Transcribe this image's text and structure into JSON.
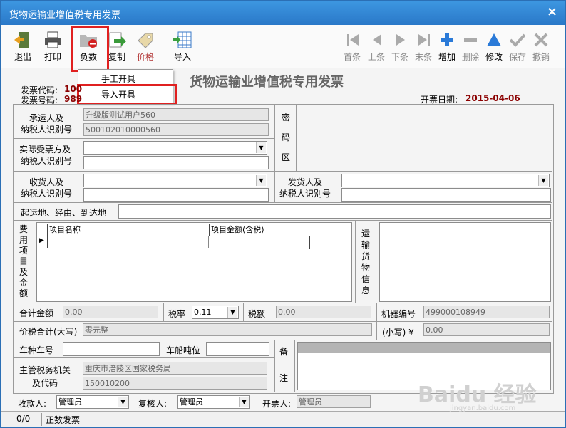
{
  "window": {
    "title": "货物运输业增值税专用发票",
    "close": "×"
  },
  "toolbar": {
    "exit": "退出",
    "print": "打印",
    "negative": "负数",
    "copy": "复制",
    "price": "价格",
    "import": "导入",
    "first": "首条",
    "prev": "上条",
    "next": "下条",
    "last": "末条",
    "add": "增加",
    "delete": "删除",
    "modify": "修改",
    "save": "保存",
    "undo": "撤销"
  },
  "menu": {
    "manual": "手工开具",
    "import": "导入开具"
  },
  "form": {
    "title": "货物运输业增值税专用发票",
    "code_label": "发票代码:",
    "code_value": "100",
    "number_label": "发票号码:",
    "number_value": "989",
    "date_label": "开票日期:",
    "date_value": "2015-04-06",
    "carrier_label_1": "承运人及",
    "carrier_label_2": "纳税人识别号",
    "carrier_name": "升级版测试用户560",
    "carrier_taxid": "500102010000560",
    "cipher_label": "密\n码\n区",
    "cipher_1": "密",
    "cipher_2": "码",
    "cipher_3": "区",
    "recipient_label_1": "实际受票方及",
    "recipient_label_2": "纳税人识别号",
    "consignee_label_1": "收货人及",
    "consignee_label_2": "纳税人识别号",
    "shipper_label_1": "发货人及",
    "shipper_label_2": "纳税人识别号",
    "route_label": "起运地、经由、到达地",
    "fee_chars": [
      "费",
      "用",
      "项",
      "目",
      "及",
      "金",
      "额"
    ],
    "grid_col1": "项目名称",
    "grid_col2": "项目金额(含税)",
    "cargo_chars": [
      "运",
      "输",
      "货",
      "物",
      "信",
      "息"
    ],
    "total_label": "合计金额",
    "total_value": "0.00",
    "rate_label": "税率",
    "rate_value": "0.11",
    "tax_label": "税额",
    "tax_value": "0.00",
    "machine_label": "机器编号",
    "machine_value": "499000108949",
    "sum_upper_label": "价税合计(大写)",
    "sum_upper_value": "零元整",
    "sum_lower_label": "(小写) ¥",
    "sum_lower_value": "0.00",
    "vehicle_label": "车种车号",
    "tonnage_label": "车船吨位",
    "remark_1": "备",
    "remark_2": "注",
    "authority_label_1": "主管税务机关",
    "authority_label_2": "及代码",
    "authority_name": "重庆市涪陵区国家税务局",
    "authority_code": "150010200",
    "payee_label": "收款人:",
    "payee_value": "管理员",
    "reviewer_label": "复核人:",
    "reviewer_value": "管理员",
    "drawer_label": "开票人:",
    "drawer_value": "管理员"
  },
  "status": {
    "count": "0/0",
    "type": "正数发票"
  },
  "watermark": {
    "brand": "Baidu 经验",
    "url": "jingyan.baidu.com"
  }
}
